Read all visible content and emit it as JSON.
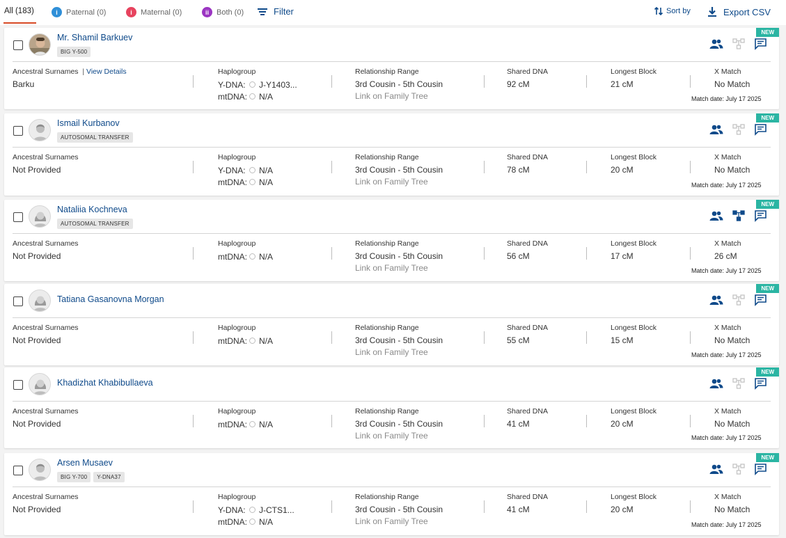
{
  "tabs": {
    "all": "All (183)",
    "paternal": "Paternal (0)",
    "maternal": "Maternal (0)",
    "both": "Both (0)",
    "filter": "Filter"
  },
  "toolbar": {
    "sort_by": "Sort by",
    "export": "Export CSV"
  },
  "labels": {
    "ancestral": "Ancestral Surnames",
    "view_details": "View Details",
    "haplogroup": "Haplogroup",
    "ydna": "Y-DNA:",
    "mtdna": "mtDNA:",
    "relationship": "Relationship Range",
    "shared": "Shared DNA",
    "longest": "Longest Block",
    "xmatch": "X Match",
    "new": "NEW",
    "link_tree": "Link on Family Tree"
  },
  "colors": {
    "accent": "#d84a25",
    "link": "#0f4a8a",
    "new_tag": "#2bb5a3",
    "paternal": "#2f8fd8",
    "maternal": "#e7435e",
    "both": "#9b35c2"
  },
  "matches": [
    {
      "name": "Mr. Shamil Barkuev",
      "badges": [
        "BIG Y-500"
      ],
      "avatar": "photo",
      "surnames": "Barku",
      "ydna": "J-Y1403...",
      "mtdna": "N/A",
      "relationship": "3rd Cousin - 5th Cousin",
      "shared": "92 cM",
      "longest": "21 cM",
      "xmatch": "No Match",
      "match_date": "Match date: July 17 2025",
      "tree_linked": false
    },
    {
      "name": "Ismail Kurbanov",
      "badges": [
        "AUTOSOMAL TRANSFER"
      ],
      "avatar": "male",
      "surnames": "Not Provided",
      "ydna": "N/A",
      "mtdna": "N/A",
      "relationship": "3rd Cousin - 5th Cousin",
      "shared": "78 cM",
      "longest": "20 cM",
      "xmatch": "No Match",
      "match_date": "Match date: July 17 2025",
      "tree_linked": false
    },
    {
      "name": "Nataliia Kochneva",
      "badges": [
        "AUTOSOMAL TRANSFER"
      ],
      "avatar": "female",
      "surnames": "Not Provided",
      "ydna": null,
      "mtdna": "N/A",
      "relationship": "3rd Cousin - 5th Cousin",
      "shared": "56 cM",
      "longest": "17 cM",
      "xmatch": "26 cM",
      "match_date": "Match date: July 17 2025",
      "tree_linked": true
    },
    {
      "name": "Tatiana Gasanovna Morgan",
      "badges": [],
      "avatar": "female",
      "surnames": "Not Provided",
      "ydna": null,
      "mtdna": "N/A",
      "relationship": "3rd Cousin - 5th Cousin",
      "shared": "55 cM",
      "longest": "15 cM",
      "xmatch": "No Match",
      "match_date": "Match date: July 17 2025",
      "tree_linked": false
    },
    {
      "name": "Khadizhat Khabibullaeva",
      "badges": [],
      "avatar": "female",
      "surnames": "Not Provided",
      "ydna": null,
      "mtdna": "N/A",
      "relationship": "3rd Cousin - 5th Cousin",
      "shared": "41 cM",
      "longest": "20 cM",
      "xmatch": "No Match",
      "match_date": "Match date: July 17 2025",
      "tree_linked": false
    },
    {
      "name": "Arsen Musaev",
      "badges": [
        "BIG Y-700",
        "Y-DNA37"
      ],
      "avatar": "male",
      "surnames": "Not Provided",
      "ydna": "J-CTS1...",
      "mtdna": "N/A",
      "relationship": "3rd Cousin - 5th Cousin",
      "shared": "41 cM",
      "longest": "20 cM",
      "xmatch": "No Match",
      "match_date": "Match date: July 17 2025",
      "tree_linked": false
    }
  ]
}
